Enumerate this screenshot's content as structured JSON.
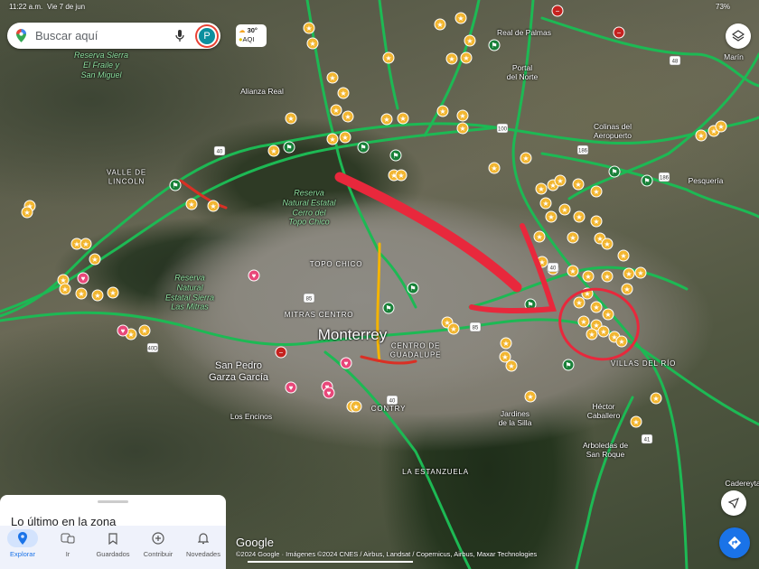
{
  "status_bar": {
    "time": "11:22 a.m.",
    "date": "Vie 7 de jun",
    "battery": "73%"
  },
  "search": {
    "placeholder": "Buscar aquí",
    "avatar_letter": "P"
  },
  "weather": {
    "temp": "30°",
    "aqi": "AQI"
  },
  "map": {
    "type": "satellite",
    "traffic": true,
    "labels": [
      {
        "text": "Reserva Sierra\nEl Fraile y\nSan Miguel",
        "style": "green"
      },
      {
        "text": "Alianza Real",
        "style": ""
      },
      {
        "text": "Real de Palmas",
        "style": ""
      },
      {
        "text": "Portal\ndel Norte",
        "style": ""
      },
      {
        "text": "Marín",
        "style": ""
      },
      {
        "text": "Colinas del\nAeropuerto",
        "style": ""
      },
      {
        "text": "Pesquería",
        "style": ""
      },
      {
        "text": "VALLE DE\nLINCOLN",
        "style": "caps"
      },
      {
        "text": "Reserva\nNatural Estatal\nCerro del\nTopo Chico",
        "style": "green"
      },
      {
        "text": "TOPO CHICO",
        "style": "caps"
      },
      {
        "text": "Reserva\nNatural\nEstatal Sierra\nLas Mitras",
        "style": "green"
      },
      {
        "text": "MITRAS CENTRO",
        "style": "caps"
      },
      {
        "text": "Monterrey",
        "style": "big"
      },
      {
        "text": "CENTRO DE\nGUADALUPE",
        "style": "caps"
      },
      {
        "text": "San Pedro\nGarza García",
        "style": "mid"
      },
      {
        "text": "Los Encinos",
        "style": ""
      },
      {
        "text": "CONTRY",
        "style": "caps"
      },
      {
        "text": "LA ESTANZUELA",
        "style": "caps"
      },
      {
        "text": "VILLAS DEL RÍO",
        "style": "caps"
      },
      {
        "text": "Jardines\nde la Silla",
        "style": ""
      },
      {
        "text": "Héctor\nCaballero",
        "style": ""
      },
      {
        "text": "Arboledas de\nSan Roque",
        "style": ""
      },
      {
        "text": "Cadereyta",
        "style": ""
      }
    ],
    "road_shields": [
      "100",
      "40",
      "85",
      "48",
      "186",
      "186",
      "41",
      "40",
      "40D",
      "85",
      "40"
    ],
    "colors": {
      "traffic_fast": "#1db954",
      "traffic_slow": "#f5b400",
      "traffic_jam": "#d93025",
      "poi_star": "#f2b631",
      "poi_heart": "#e8487a",
      "poi_flag": "#188038",
      "annotation": "#e8283c"
    }
  },
  "bottom_sheet": {
    "title": "Lo último en la zona"
  },
  "nav": [
    {
      "label": "Explorar",
      "icon": "pin-icon",
      "active": true
    },
    {
      "label": "Ir",
      "icon": "transit-icon"
    },
    {
      "label": "Guardados",
      "icon": "bookmark-icon"
    },
    {
      "label": "Contribuir",
      "icon": "add-circle-icon"
    },
    {
      "label": "Novedades",
      "icon": "bell-icon"
    }
  ],
  "attribution": {
    "logo": "Google",
    "text": "©2024 Google · Imágenes ©2024 CNES / Airbus, Landsat / Copernicus, Airbus, Maxar Technologies"
  }
}
